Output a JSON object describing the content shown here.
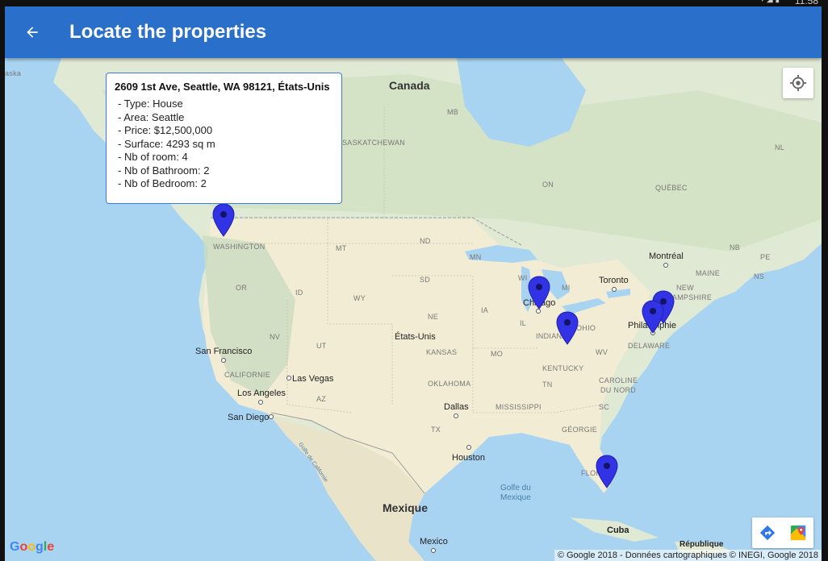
{
  "status": {
    "time": "11:58"
  },
  "appbar": {
    "title": "Locate the properties",
    "back_icon": "arrow-left-icon"
  },
  "infowindow": {
    "title": "2609 1st Ave, Seattle, WA 98121, États-Unis",
    "lines": [
      "- Type: House",
      "- Area: Seattle",
      "- Price: $12,500,000",
      "- Surface: 4293 sq m",
      "- Nb of room: 4",
      "- Nb of Bathroom: 2",
      "- Nb of Bedroom: 2"
    ]
  },
  "map": {
    "countries": {
      "canada": "Canada",
      "usa": "États-Unis",
      "mexico": "Mexique",
      "cuba": "Cuba",
      "dominican": "République"
    },
    "cities": {
      "seattle": "",
      "san_francisco": "San Francisco",
      "las_vegas": "Las Vegas",
      "los_angeles": "Los Angeles",
      "san_diego": "San Diego",
      "dallas": "Dallas",
      "houston": "Houston",
      "chicago": "Chicago",
      "toronto": "Toronto",
      "montreal": "Montréal",
      "philadelphia": "Philadelphie",
      "mexico_city": "Mexico"
    },
    "states": {
      "washington": "WASHINGTON",
      "or": "OR",
      "id": "ID",
      "mt": "MT",
      "wy": "WY",
      "nv": "NV",
      "ut": "UT",
      "california": "CALIFORNIE",
      "az": "AZ",
      "nd": "ND",
      "sd": "SD",
      "ne": "NE",
      "kansas": "KANSAS",
      "oklahoma": "OKLAHOMA",
      "tx": "TX",
      "mn": "MN",
      "ia": "IA",
      "mo": "MO",
      "wi": "WI",
      "il": "IL",
      "mi": "MI",
      "indiana": "INDIANA",
      "ohio": "OHIO",
      "kentucky": "KENTUCKY",
      "tn": "TN",
      "mississippi": "MISSISSIPPI",
      "georgia": "GÉORGIE",
      "wv": "WV",
      "delaware": "DELAWARE",
      "carolina_n": "CAROLINE",
      "carolina_s": "DU NORD",
      "sc": "SC",
      "florida": "FLOR",
      "mb": "MB",
      "saskatchewan": "SASKATCHEWAN",
      "on": "ON",
      "quebec": "QUÉBEC",
      "nl": "NL",
      "nb": "NB",
      "pe": "PE",
      "ns": "NS",
      "maine": "MAINE",
      "new_hampshire_a": "NEW",
      "new_hampshire_b": "HAMPSHIRE",
      "alaska": "aska"
    },
    "water": {
      "gulf_a": "Golfe du",
      "gulf_b": "Mexique",
      "gulf_cal": "Golfe de Californie"
    },
    "markers_count_label": "",
    "colors": {
      "marker": "#3333e6",
      "appbar": "#2a6fc9",
      "water": "#a8d4f2",
      "land": "#dfe9d3"
    }
  },
  "controls": {
    "my_location_icon": "my-location-icon",
    "directions_icon": "directions-icon",
    "maps_icon": "google-maps-icon"
  },
  "footer": {
    "logo": "Google",
    "attribution": "© Google 2018 - Données cartographiques © INEGI, Google 2018"
  }
}
